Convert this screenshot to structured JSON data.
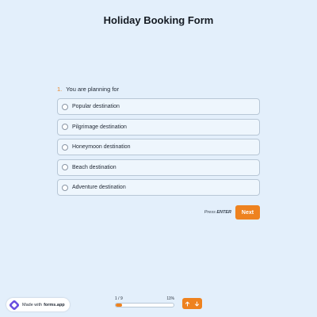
{
  "form": {
    "title": "Holiday Booking Form"
  },
  "question": {
    "number": "1.",
    "text": "You are planning for",
    "options": [
      {
        "label": "Popular destination"
      },
      {
        "label": "Pilgrimage destination"
      },
      {
        "label": "Honeymoon destination"
      },
      {
        "label": "Beach destination"
      },
      {
        "label": "Adventure destination"
      }
    ]
  },
  "actions": {
    "hint_prefix": "Press",
    "hint_key": "ENTER",
    "next_label": "Next"
  },
  "footer": {
    "badge_prefix": "Made with",
    "badge_brand": "forms.app",
    "progress_text": "1 / 9",
    "progress_percent_text": "11%",
    "progress_fraction": 0.11,
    "up_icon": "arrow-up-icon",
    "down_icon": "arrow-down-icon"
  },
  "colors": {
    "background": "#e3effb",
    "accent": "#ee821f",
    "option_bg": "#eef6fd",
    "option_border": "#b8c7d6"
  }
}
